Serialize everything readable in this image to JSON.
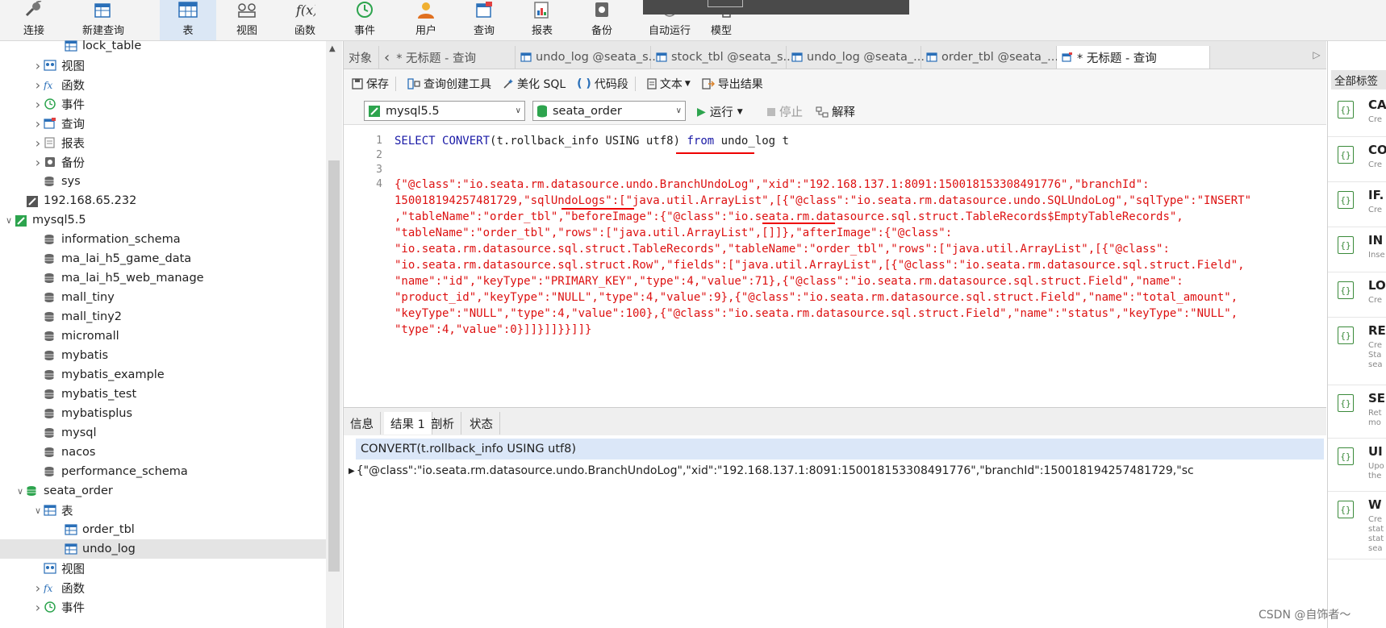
{
  "toolbar": {
    "items": [
      {
        "label": "连接",
        "icon": "connect-icon"
      },
      {
        "label": "新建查询",
        "icon": "new-query-icon"
      },
      {
        "label": "表",
        "icon": "table-icon"
      },
      {
        "label": "视图",
        "icon": "view-icon"
      },
      {
        "label": "函数",
        "icon": "function-icon"
      },
      {
        "label": "事件",
        "icon": "event-icon"
      },
      {
        "label": "用户",
        "icon": "user-icon"
      },
      {
        "label": "查询",
        "icon": "query-icon"
      },
      {
        "label": "报表",
        "icon": "report-icon"
      },
      {
        "label": "备份",
        "icon": "backup-icon"
      },
      {
        "label": "自动运行",
        "icon": "auto-run-icon"
      },
      {
        "label": "模型",
        "icon": "model-icon"
      }
    ],
    "active": "表",
    "accent": "#dbe7f5"
  },
  "sidebar": {
    "tree": [
      {
        "label": "lock_table",
        "icon": "table-icon",
        "indent": 3,
        "chev": ""
      },
      {
        "label": "视图",
        "icon": "view-icon",
        "indent": 2,
        "chev": ">"
      },
      {
        "label": "函数",
        "icon": "function-icon",
        "indent": 2,
        "chev": ">"
      },
      {
        "label": "事件",
        "icon": "event-icon",
        "indent": 2,
        "chev": ">"
      },
      {
        "label": "查询",
        "icon": "query-icon",
        "indent": 2,
        "chev": ">"
      },
      {
        "label": "报表",
        "icon": "report-icon",
        "indent": 2,
        "chev": ">"
      },
      {
        "label": "备份",
        "icon": "backup-icon",
        "indent": 2,
        "chev": ">"
      },
      {
        "label": "sys",
        "icon": "database-icon",
        "indent": 2,
        "chev": ""
      },
      {
        "label": "192.168.65.232",
        "icon": "connection-icon",
        "indent": 1,
        "chev": ""
      },
      {
        "label": "mysql5.5",
        "icon": "connection-green-icon",
        "indent": 0,
        "chev": "v"
      },
      {
        "label": "information_schema",
        "icon": "database-icon",
        "indent": 2,
        "chev": ""
      },
      {
        "label": "ma_lai_h5_game_data",
        "icon": "database-icon",
        "indent": 2,
        "chev": ""
      },
      {
        "label": "ma_lai_h5_web_manage",
        "icon": "database-icon",
        "indent": 2,
        "chev": ""
      },
      {
        "label": "mall_tiny",
        "icon": "database-icon",
        "indent": 2,
        "chev": ""
      },
      {
        "label": "mall_tiny2",
        "icon": "database-icon",
        "indent": 2,
        "chev": ""
      },
      {
        "label": "micromall",
        "icon": "database-icon",
        "indent": 2,
        "chev": ""
      },
      {
        "label": "mybatis",
        "icon": "database-icon",
        "indent": 2,
        "chev": ""
      },
      {
        "label": "mybatis_example",
        "icon": "database-icon",
        "indent": 2,
        "chev": ""
      },
      {
        "label": "mybatis_test",
        "icon": "database-icon",
        "indent": 2,
        "chev": ""
      },
      {
        "label": "mybatisplus",
        "icon": "database-icon",
        "indent": 2,
        "chev": ""
      },
      {
        "label": "mysql",
        "icon": "database-icon",
        "indent": 2,
        "chev": ""
      },
      {
        "label": "nacos",
        "icon": "database-icon",
        "indent": 2,
        "chev": ""
      },
      {
        "label": "performance_schema",
        "icon": "database-icon",
        "indent": 2,
        "chev": ""
      },
      {
        "label": "seata_order",
        "icon": "database-green-icon",
        "indent": 1,
        "chev": "v"
      },
      {
        "label": "表",
        "icon": "table-icon",
        "indent": 2,
        "chev": "v"
      },
      {
        "label": "order_tbl",
        "icon": "table-icon",
        "indent": 3,
        "chev": ""
      },
      {
        "label": "undo_log",
        "icon": "table-icon",
        "indent": 3,
        "chev": "",
        "selected": true
      },
      {
        "label": "视图",
        "icon": "view-icon",
        "indent": 2,
        "chev": ""
      },
      {
        "label": "函数",
        "icon": "function-icon",
        "indent": 2,
        "chev": ">"
      },
      {
        "label": "事件",
        "icon": "event-icon",
        "indent": 2,
        "chev": ">"
      }
    ]
  },
  "tabs": {
    "items": [
      {
        "label": "对象",
        "icon": ""
      },
      {
        "label": "* 无标题 - 查询",
        "icon": ""
      },
      {
        "label": "undo_log @seata_s...",
        "icon": "table-icon"
      },
      {
        "label": "stock_tbl @seata_s...",
        "icon": "table-icon"
      },
      {
        "label": "undo_log @seata_...",
        "icon": "table-icon"
      },
      {
        "label": "order_tbl @seata_...",
        "icon": "table-icon"
      },
      {
        "label": "* 无标题 - 查询",
        "icon": "query-icon",
        "active": true
      }
    ]
  },
  "query_toolbar": {
    "save": "保存",
    "builder": "查询创建工具",
    "beautify": "美化 SQL",
    "snippet": "代码段",
    "text": "文本",
    "export": "导出结果"
  },
  "selectors": {
    "connection": "mysql5.5",
    "database": "seata_order",
    "run": "运行",
    "stop": "停止",
    "explain": "解释"
  },
  "editor": {
    "line1_kw1": "SELECT",
    "line1_fn": "CONVERT",
    "line1_mid": "(t.rollback_info USING utf8)",
    "line1_kw2": "from",
    "line1_tail": "undo_log t",
    "line_numbers": [
      "1",
      "2",
      "3",
      "4"
    ],
    "json_lines": [
      "{\"@class\":\"io.seata.rm.datasource.undo.BranchUndoLog\",\"xid\":\"192.168.137.1:8091:150018153308491776\",\"branchId\":",
      "150018194257481729,\"sqlUndoLogs\":[\"java.util.ArrayList\",[{\"@class\":\"io.seata.rm.datasource.undo.SQLUndoLog\",\"sqlType\":\"INSERT\"",
      ",\"tableName\":\"order_tbl\",\"beforeImage\":{\"@class\":\"io.seata.rm.datasource.sql.struct.TableRecords$EmptyTableRecords\",",
      "\"tableName\":\"order_tbl\",\"rows\":[\"java.util.ArrayList\",[]]},\"afterImage\":{\"@class\":",
      "\"io.seata.rm.datasource.sql.struct.TableRecords\",\"tableName\":\"order_tbl\",\"rows\":[\"java.util.ArrayList\",[{\"@class\":",
      "\"io.seata.rm.datasource.sql.struct.Row\",\"fields\":[\"java.util.ArrayList\",[{\"@class\":\"io.seata.rm.datasource.sql.struct.Field\",",
      "\"name\":\"id\",\"keyType\":\"PRIMARY_KEY\",\"type\":4,\"value\":71},{\"@class\":\"io.seata.rm.datasource.sql.struct.Field\",\"name\":",
      "\"product_id\",\"keyType\":\"NULL\",\"type\":4,\"value\":9},{\"@class\":\"io.seata.rm.datasource.sql.struct.Field\",\"name\":\"total_amount\",",
      "\"keyType\":\"NULL\",\"type\":4,\"value\":100},{\"@class\":\"io.seata.rm.datasource.sql.struct.Field\",\"name\":\"status\",\"keyType\":\"NULL\",",
      "\"type\":4,\"value\":0}]]}]]}}]]}"
    ]
  },
  "result_tabs": [
    "信息",
    "结果 1",
    "剖析",
    "状态"
  ],
  "result_active": "结果 1",
  "grid": {
    "column": "CONVERT(t.rollback_info USING utf8)",
    "row": "{\"@class\":\"io.seata.rm.datasource.undo.BranchUndoLog\",\"xid\":\"192.168.137.1:8091:150018153308491776\",\"branchId\":150018194257481729,\"sc"
  },
  "right_panel": {
    "header": "全部标签",
    "items": [
      {
        "title": "CA",
        "sub": [
          "Cre"
        ]
      },
      {
        "title": "CO",
        "sub": [
          "Cre"
        ]
      },
      {
        "title": "IF.",
        "sub": [
          "Cre"
        ]
      },
      {
        "title": "IN",
        "sub": [
          "Inse"
        ]
      },
      {
        "title": "LO",
        "sub": [
          "Cre"
        ]
      },
      {
        "title": "RE",
        "sub": [
          "Cre",
          "Sta",
          "sea"
        ]
      },
      {
        "title": "SE",
        "sub": [
          "Ret",
          "mo"
        ]
      },
      {
        "title": "UI",
        "sub": [
          "Upo",
          "the"
        ]
      },
      {
        "title": "W",
        "sub": [
          "Cre",
          "stat",
          "stat",
          "sea"
        ]
      }
    ]
  },
  "watermark": "CSDN @自饰者～"
}
